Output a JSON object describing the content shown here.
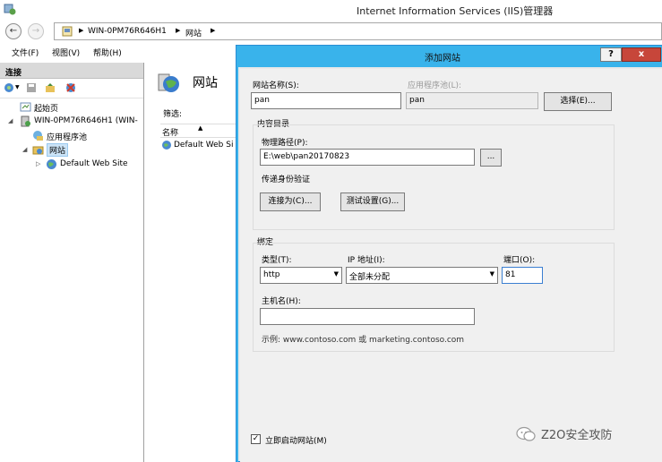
{
  "window": {
    "title": "Internet Information Services (IIS)管理器"
  },
  "address": {
    "crumbs": [
      "WIN-0PM76R646H1",
      "网站"
    ]
  },
  "menu": {
    "items": [
      "文件(F)",
      "视图(V)",
      "帮助(H)"
    ]
  },
  "connections": {
    "header": "连接",
    "tree": {
      "start_page": "起始页",
      "server": "WIN-0PM76R646H1 (WIN-",
      "app_pools": "应用程序池",
      "sites": "网站",
      "default_site": "Default Web Site"
    }
  },
  "main": {
    "title": "网站",
    "filter_label": "筛选:",
    "column_name": "名称",
    "rows": [
      "Default Web Si"
    ]
  },
  "dialog": {
    "title": "添加网站",
    "help": "?",
    "close": "x",
    "site_name_label": "网站名称(S):",
    "site_name_value": "pan",
    "app_pool_label": "应用程序池(L):",
    "app_pool_value": "pan",
    "select_button": "选择(E)...",
    "content_dir_header": "内容目录",
    "physical_path_label": "物理路径(P):",
    "physical_path_value": "E:\\web\\pan20170823",
    "browse_button": "...",
    "pass_auth_label": "传递身份验证",
    "connect_as_button": "连接为(C)...",
    "test_settings_button": "测试设置(G)...",
    "binding_header": "绑定",
    "type_label": "类型(T):",
    "type_value": "http",
    "ip_label": "IP 地址(I):",
    "ip_value": "全部未分配",
    "port_label": "端口(O):",
    "port_value": "81",
    "hostname_label": "主机名(H):",
    "hostname_value": "",
    "example_text": "示例: www.contoso.com 或 marketing.contoso.com",
    "start_now_label": "立即启动网站(M)",
    "start_now_checked": "✓"
  },
  "watermark": {
    "text": "Z2O安全攻防"
  }
}
